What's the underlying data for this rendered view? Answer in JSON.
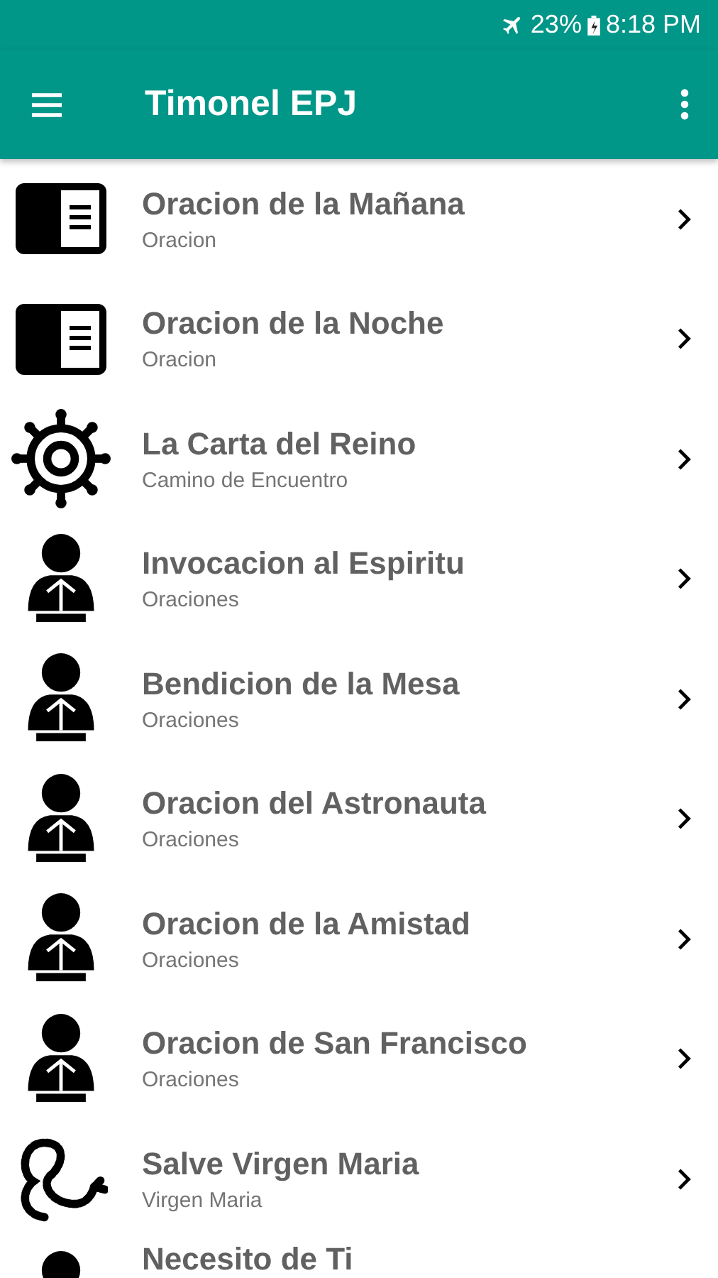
{
  "status_bar": {
    "battery": "23%",
    "time": "8:18 PM"
  },
  "app_bar": {
    "title": "Timonel EPJ"
  },
  "items": [
    {
      "kind": "book",
      "title": "Oracion de la Mañana",
      "subtitle": "Oracion"
    },
    {
      "kind": "book",
      "title": "Oracion de la Noche",
      "subtitle": "Oracion"
    },
    {
      "kind": "gear",
      "title": "La Carta del Reino",
      "subtitle": "Camino de Encuentro"
    },
    {
      "kind": "praying",
      "title": "Invocacion al Espiritu",
      "subtitle": "Oraciones"
    },
    {
      "kind": "praying",
      "title": "Bendicion de la Mesa",
      "subtitle": "Oraciones"
    },
    {
      "kind": "praying",
      "title": "Oracion del Astronauta",
      "subtitle": "Oraciones"
    },
    {
      "kind": "praying",
      "title": "Oracion de la Amistad",
      "subtitle": "Oraciones"
    },
    {
      "kind": "praying",
      "title": "Oracion de San Francisco",
      "subtitle": "Oraciones"
    },
    {
      "kind": "rosary",
      "title": "Salve Virgen Maria",
      "subtitle": "Virgen Maria"
    },
    {
      "kind": "praying",
      "title": "Necesito de Ti"
    }
  ]
}
